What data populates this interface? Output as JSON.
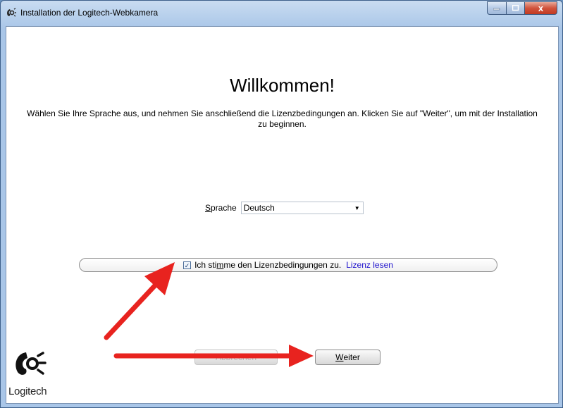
{
  "window": {
    "title": "Installation der Logitech-Webkamera",
    "caption_close": "x"
  },
  "main": {
    "heading": "Willkommen!",
    "intro": "Wählen Sie Ihre Sprache aus, und nehmen Sie anschließend die Lizenzbedingungen an. Klicken Sie auf \"Weiter\", um mit der Installation zu beginnen.",
    "language": {
      "label_access_key": "S",
      "label_rest": "prache",
      "selected": "Deutsch"
    },
    "license": {
      "checked": true,
      "text_before": "Ich sti",
      "text_access_key": "m",
      "text_after": "me den Lizenzbedingungen zu.",
      "link": "Lizenz lesen"
    },
    "buttons": {
      "cancel": "Abbrechen",
      "next_access_key": "W",
      "next_rest": "eiter"
    },
    "logo_text": "Logitech"
  },
  "colors": {
    "annotation_arrow": "#e8231f",
    "link": "#1a0dcc"
  }
}
